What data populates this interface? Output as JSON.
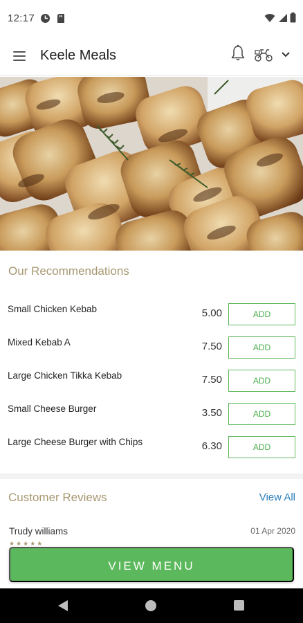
{
  "status_bar": {
    "time": "12:17",
    "left_icons": [
      "data-saver-icon",
      "sd-card-icon"
    ],
    "right_icons": [
      "wifi-icon",
      "signal-icon",
      "battery-icon"
    ]
  },
  "app_bar": {
    "title": "Keele Meals",
    "icons": [
      "menu-icon",
      "bell-icon",
      "delivery-scooter-icon",
      "chevron-down-icon"
    ]
  },
  "hero": {
    "image": "grilled chicken kebab skewers"
  },
  "recommendations": {
    "title": "Our Recommendations",
    "add_label": "ADD",
    "items": [
      {
        "name": "Small Chicken Kebab",
        "price": "5.00"
      },
      {
        "name": "Mixed Kebab A",
        "price": "7.50"
      },
      {
        "name": "Large Chicken Tikka Kebab",
        "price": "7.50"
      },
      {
        "name": "Small Cheese Burger",
        "price": "3.50"
      },
      {
        "name": "Large Cheese Burger with Chips",
        "price": "6.30"
      }
    ]
  },
  "reviews": {
    "title": "Customer Reviews",
    "view_all": "View All",
    "first": {
      "name": "Trudy williams",
      "date": "01 Apr 2020",
      "stars": "★★★★★"
    }
  },
  "view_menu": {
    "label": "VIEW MENU"
  },
  "nav_bar": {
    "icons": [
      "back-icon",
      "home-icon",
      "recents-icon"
    ]
  },
  "colors": {
    "accent_green": "#5cb85c",
    "section_title": "#a79872",
    "link_blue": "#2a7db8"
  }
}
